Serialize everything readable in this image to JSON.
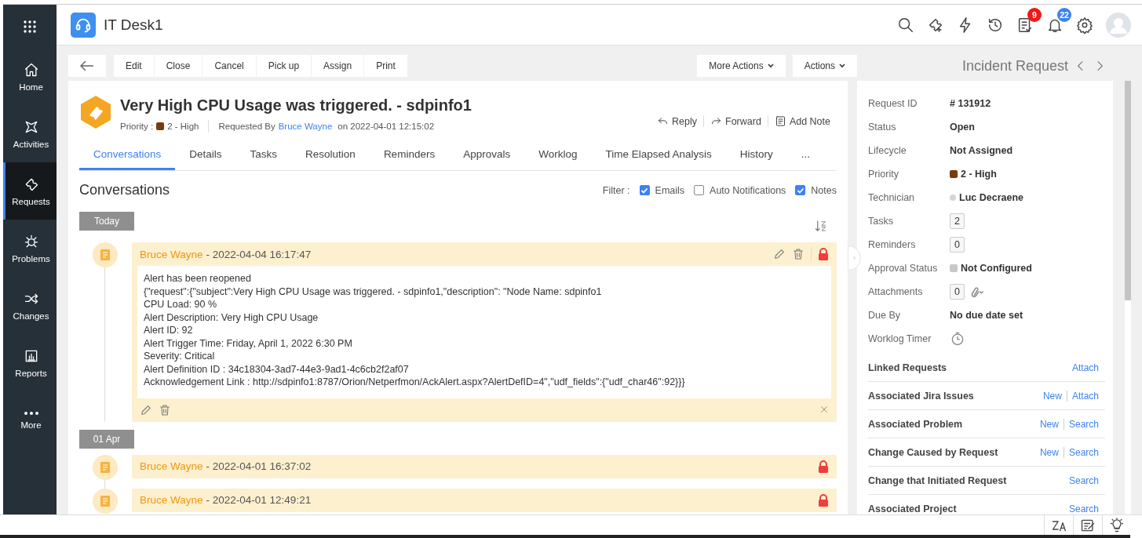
{
  "app": {
    "title": "IT Desk1"
  },
  "header_icons": [
    {
      "kind": "search"
    },
    {
      "kind": "sparkle"
    },
    {
      "kind": "bolt"
    },
    {
      "kind": "history"
    },
    {
      "kind": "tasks",
      "badge": "9",
      "color": "#f01818"
    },
    {
      "kind": "bell",
      "badge": "22",
      "color": "#3d82f0"
    },
    {
      "kind": "settings"
    },
    {
      "kind": "avatar"
    }
  ],
  "sidebar": {
    "items": [
      {
        "label": "Home",
        "kind": "home",
        "selected": false
      },
      {
        "label": "Activities",
        "kind": "activities",
        "selected": false
      },
      {
        "label": "Requests",
        "kind": "requests",
        "selected": true
      },
      {
        "label": "Problems",
        "kind": "problems",
        "selected": false
      },
      {
        "label": "Changes",
        "kind": "changes",
        "selected": false
      },
      {
        "label": "Reports",
        "kind": "reports",
        "selected": false
      },
      {
        "label": "More",
        "kind": "more",
        "selected": false
      }
    ]
  },
  "toolbar": {
    "buttons": [
      "Edit",
      "Close",
      "Cancel",
      "Pick up",
      "Assign",
      "Print"
    ],
    "dropdowns": [
      "More Actions",
      "Actions"
    ],
    "module_title": "Incident Request"
  },
  "request": {
    "title": "Very High CPU Usage was triggered. - sdpinfo1",
    "priority_label": "Priority :",
    "priority": {
      "label": "2 - High",
      "color": "#7a3a0a"
    },
    "requested_by_label": "Requested By",
    "requester": "Bruce Wayne",
    "requested_on": "on 2022-04-01 12:15:02",
    "actions": [
      {
        "kind": "reply",
        "label": "Reply"
      },
      {
        "kind": "forward",
        "label": "Forward"
      },
      {
        "kind": "note",
        "label": "Add Note"
      }
    ]
  },
  "tabs": [
    {
      "label": "Conversations",
      "selected": true
    },
    {
      "label": "Details",
      "selected": false
    },
    {
      "label": "Tasks",
      "selected": false
    },
    {
      "label": "Resolution",
      "selected": false
    },
    {
      "label": "Reminders",
      "selected": false
    },
    {
      "label": "Approvals",
      "selected": false
    },
    {
      "label": "Worklog",
      "selected": false
    },
    {
      "label": "Time Elapsed Analysis",
      "selected": false
    },
    {
      "label": "History",
      "selected": false
    },
    {
      "label": "...",
      "selected": false
    }
  ],
  "conversations": {
    "heading": "Conversations",
    "filter_label": "Filter :",
    "filters": [
      {
        "label": "Emails",
        "checked": true
      },
      {
        "label": "Auto Notifications",
        "checked": false
      },
      {
        "label": "Notes",
        "checked": true
      }
    ],
    "groups": [
      {
        "date": "Today",
        "entries": [
          {
            "author": "Bruce Wayne",
            "time": "- 2022-04-04 16:17:47",
            "locked": true,
            "expanded": true,
            "body": [
              "Alert has been reopened",
              "{\"request\":{\"subject\":Very High CPU Usage was triggered. - sdpinfo1,\"description\": \"Node Name: sdpinfo1",
              "CPU Load: 90 %",
              "Alert Description: Very High CPU Usage",
              "Alert ID: 92",
              "Alert Trigger Time: Friday, April 1, 2022 6:30 PM",
              "Severity: Critical",
              "Alert Definition ID : 34c18304-3ad7-44e3-9ad1-4c6cb2f2af07",
              "Acknowledgement Link : http://sdpinfo1:8787/Orion/Netperfmon/AckAlert.aspx?AlertDefID=4\",\"udf_fields\":{\"udf_char46\":92}}}"
            ]
          }
        ]
      },
      {
        "date": "01 Apr",
        "entries": [
          {
            "author": "Bruce Wayne",
            "time": "- 2022-04-01 16:37:02",
            "locked": true,
            "expanded": false
          },
          {
            "author": "Bruce Wayne",
            "time": "- 2022-04-01 12:49:21",
            "locked": true,
            "expanded": false
          }
        ]
      }
    ]
  },
  "details": {
    "fields": [
      {
        "label": "Request ID",
        "kind": "text",
        "value": "# 131912"
      },
      {
        "label": "Status",
        "kind": "text",
        "value": "Open"
      },
      {
        "label": "Lifecycle",
        "kind": "text",
        "value": "Not Assigned"
      },
      {
        "label": "Priority",
        "kind": "square",
        "value": "2 - High",
        "color": "#7a3a0a"
      },
      {
        "label": "Technician",
        "kind": "dot",
        "value": "Luc Decraene",
        "color": "#d4d4d4"
      },
      {
        "label": "Tasks",
        "kind": "count",
        "value": "2"
      },
      {
        "label": "Reminders",
        "kind": "count",
        "value": "0"
      },
      {
        "label": "Approval Status",
        "kind": "square",
        "value": "Not Configured",
        "color": "#c8c8c8"
      },
      {
        "label": "Attachments",
        "kind": "attachments",
        "value": "0"
      },
      {
        "label": "Due By",
        "kind": "text",
        "value": "No due date set"
      },
      {
        "label": "Worklog Timer",
        "kind": "timer"
      }
    ],
    "sections": [
      {
        "title": "Linked Requests",
        "links": [
          "Attach"
        ]
      },
      {
        "title": "Associated Jira Issues",
        "links": [
          "New",
          "Attach"
        ]
      },
      {
        "title": "Associated Problem",
        "links": [
          "New",
          "Search"
        ]
      },
      {
        "title": "Change Caused by Request",
        "links": [
          "New",
          "Search"
        ]
      },
      {
        "title": "Change that Initiated Request",
        "links": [
          "Search"
        ]
      },
      {
        "title": "Associated Project",
        "links": [
          "Search"
        ]
      }
    ]
  },
  "footer_icons": [
    {
      "kind": "translate"
    },
    {
      "kind": "notes"
    },
    {
      "kind": "bulb"
    }
  ]
}
